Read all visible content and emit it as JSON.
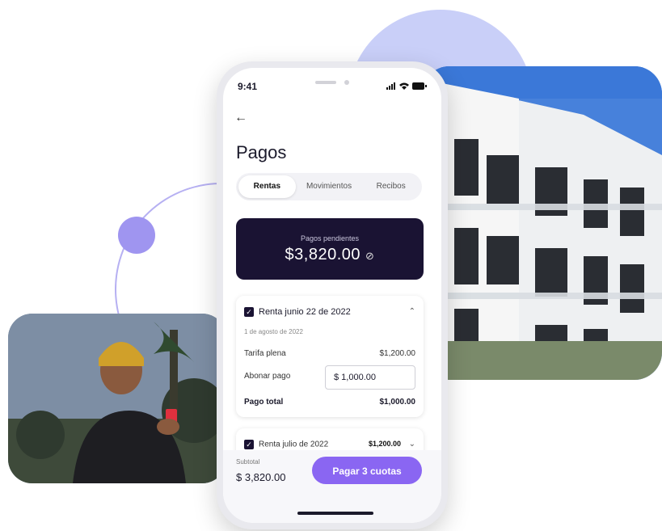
{
  "status": {
    "time": "9:41"
  },
  "screen": {
    "title": "Pagos",
    "tabs": [
      "Rentas",
      "Movimientos",
      "Recibos"
    ],
    "active_tab": "Rentas",
    "balance": {
      "label": "Pagos pendientes",
      "amount": "$3,820.00"
    },
    "card1": {
      "title": "Renta junio 22 de 2022",
      "subtitle": "1 de agosto de 2022",
      "tarifa_label": "Tarifa plena",
      "tarifa_value": "$1,200.00",
      "abonar_label": "Abonar pago",
      "abonar_value": "$ 1,000.00",
      "total_label": "Pago total",
      "total_value": "$1,000.00"
    },
    "card2": {
      "title": "Renta julio de 2022",
      "amount": "$1,200.00"
    },
    "footer": {
      "subtotal_label": "Subtotal",
      "subtotal_value": "$ 3,820.00",
      "pay_button": "Pagar 3 cuotas"
    }
  },
  "colors": {
    "accent": "#8a66f2",
    "dark": "#1a1333",
    "lavender": "#c9cff8"
  },
  "icons": [
    "back-arrow-icon",
    "eye-slash-icon",
    "chevron-up-icon",
    "chevron-down-icon",
    "checkbox-icon",
    "signal-icon",
    "wifi-icon",
    "battery-icon"
  ]
}
